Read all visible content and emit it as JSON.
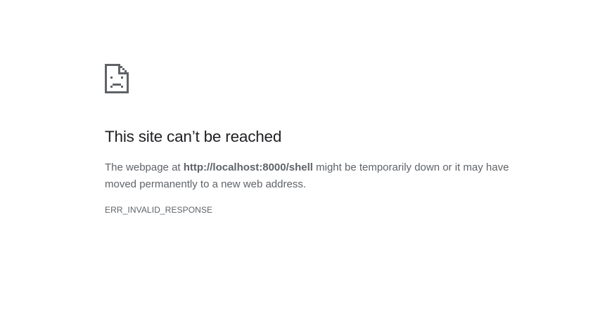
{
  "page": {
    "icon": "sad-document-icon",
    "title": "This site can’t be reached",
    "message_prefix": "The webpage at ",
    "url": "http://localhost:8000/shell",
    "message_suffix": " might be temporarily down or it may have moved permanently to a new web address.",
    "error_code": "ERR_INVALID_RESPONSE",
    "text_color": "#202124",
    "secondary_color": "#5f6368"
  }
}
